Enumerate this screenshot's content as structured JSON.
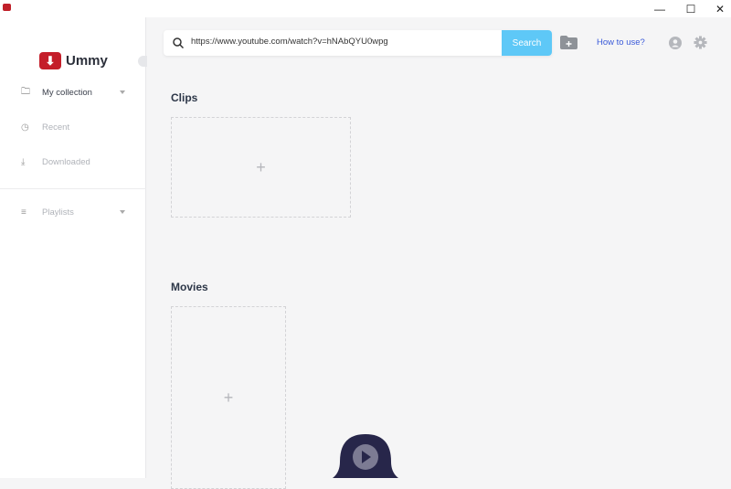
{
  "window": {
    "minimize": "—",
    "maximize": "☐",
    "close": "✕"
  },
  "app": {
    "name": "Ummy"
  },
  "sidebar": {
    "items": [
      {
        "label": "My collection",
        "icon": "folder-icon",
        "color": "#3a3f4b"
      },
      {
        "label": "Recent",
        "icon": "history-icon",
        "color": "#b0b3b9"
      },
      {
        "label": "Downloaded",
        "icon": "download-icon",
        "color": "#b0b3b9"
      },
      {
        "label": "Playlists",
        "icon": "playlist-icon",
        "color": "#b0b3b9"
      }
    ]
  },
  "search": {
    "value": "https://www.youtube.com/watch?v=hNAbQYU0wpg",
    "button": "Search"
  },
  "header": {
    "how_to": "How to use?"
  },
  "sections": {
    "clips": "Clips",
    "movies": "Movies"
  },
  "colors": {
    "accent": "#5ec8f7",
    "brand": "#c41e2a",
    "link": "#3a5ad9"
  }
}
